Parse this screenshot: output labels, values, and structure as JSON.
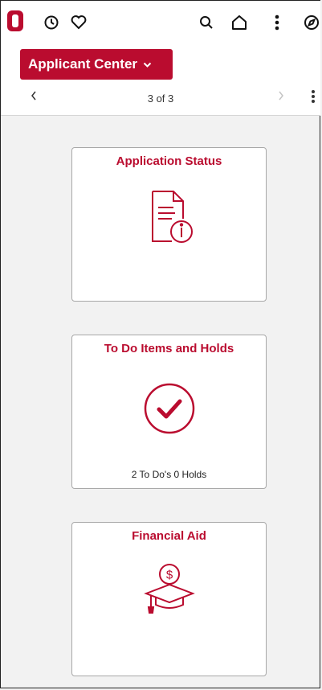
{
  "topbar": {
    "icons": [
      "logo-icon",
      "history-icon",
      "favorites-icon",
      "search-icon",
      "home-icon",
      "actions-icon",
      "navigator-icon"
    ]
  },
  "header": {
    "app_title": "Applicant Center",
    "pager_count": "3 of 3"
  },
  "tiles": [
    {
      "title": "Application Status",
      "icon": "document-info-icon",
      "status": ""
    },
    {
      "title": "To Do Items and Holds",
      "icon": "checkmark-circle-icon",
      "status": "2 To Do's  0 Holds"
    },
    {
      "title": "Financial Aid",
      "icon": "graduation-cap-dollar-icon",
      "status": ""
    }
  ],
  "colors": {
    "brand": "#ba0c2f",
    "background": "#f2f2f2"
  }
}
